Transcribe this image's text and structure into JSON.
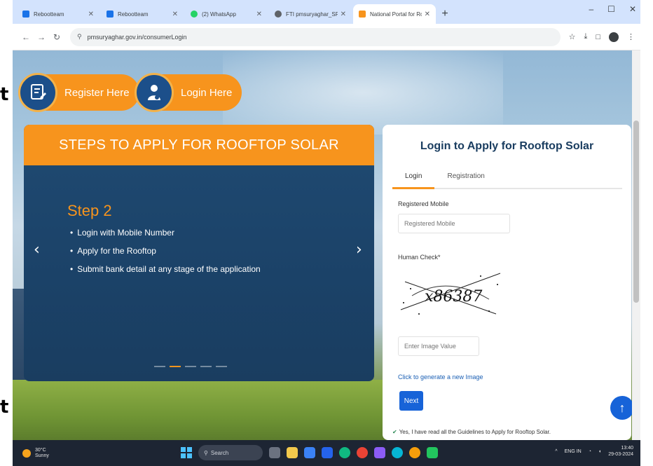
{
  "left_edge_glyphs": [
    "t",
    "t"
  ],
  "browser": {
    "tabs": [
      {
        "title": "Rebootteam",
        "favicon_color": "#1a73e8",
        "active": false
      },
      {
        "title": "Rebootteam",
        "favicon_color": "#1a73e8",
        "active": false
      },
      {
        "title": "(2) WhatsApp",
        "favicon_color": "#25d366",
        "active": false
      },
      {
        "title": "FTI pmsuryaghar_SREEPANCHA...",
        "favicon_color": "#5f6368",
        "active": false
      },
      {
        "title": "National Portal for Rooftop Solar",
        "favicon_color": "#f7941d",
        "active": true
      }
    ],
    "new_tab": "+",
    "window_controls": [
      "–",
      "☐",
      "✕"
    ],
    "url": "pmsuryaghar.gov.in/consumerLogin",
    "toolbar_icons": [
      "☆",
      "⤓",
      "□",
      "⋮"
    ]
  },
  "hero": {
    "register_button": "Register Here",
    "login_button": "Login Here"
  },
  "steps": {
    "header": "STEPS TO APPLY FOR ROOFTOP SOLAR",
    "step_title": "Step 2",
    "items": [
      "Login with Mobile Number",
      "Apply for the Rooftop",
      "Submit bank detail at any stage of the application"
    ],
    "prev_arrow": "‹",
    "next_arrow": "›",
    "current_slide": 2,
    "total_slides": 5
  },
  "login": {
    "title": "Login to Apply for Rooftop Solar",
    "tabs": [
      {
        "label": "Login",
        "active": true
      },
      {
        "label": "Registration",
        "active": false
      }
    ],
    "mobile_label": "Registered Mobile",
    "mobile_placeholder": "Registered Mobile",
    "captcha_label": "Human Check*",
    "captcha_text": "x86387",
    "captcha_placeholder": "Enter Image Value",
    "regenerate_link": "Click to generate a new Image",
    "next_button": "Next",
    "agree_text": "Yes, I have read all the Guidelines to Apply for Rooftop Solar."
  },
  "taskbar": {
    "weather_temp": "30°C",
    "weather_desc": "Sunny",
    "search_placeholder": "Search",
    "clock_time": "13:40",
    "clock_date": "29-03-2024",
    "lang": "ENG IN"
  },
  "colors": {
    "accent_orange": "#f7941d",
    "navy": "#1a3d60",
    "primary_blue": "#1763d8"
  }
}
